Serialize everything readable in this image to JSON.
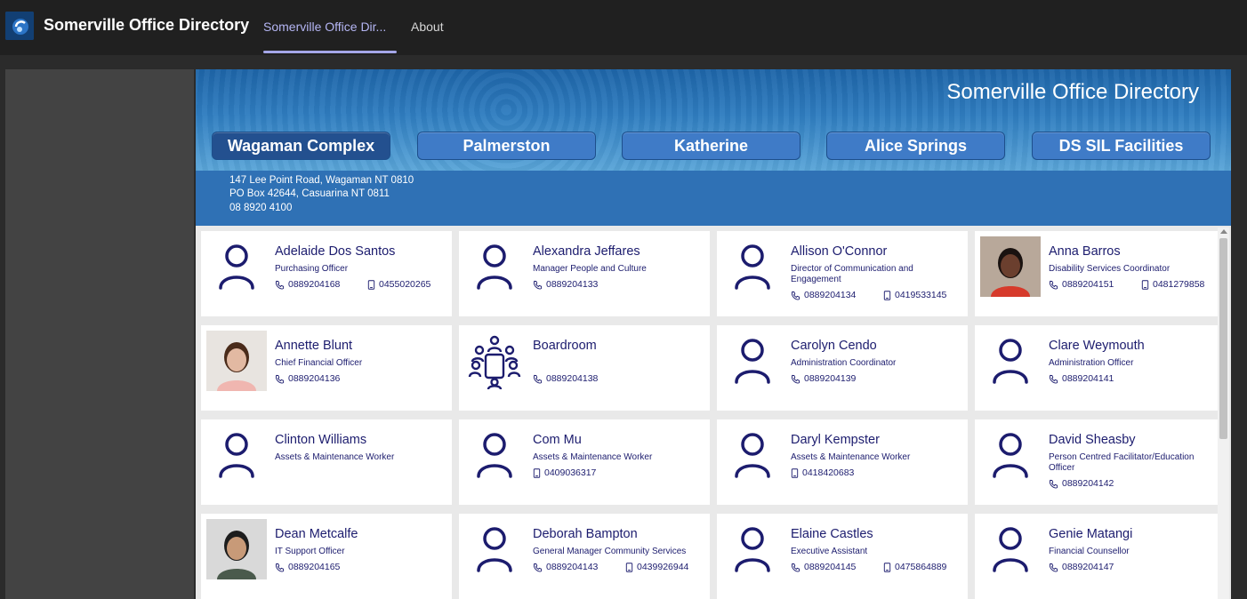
{
  "app": {
    "title": "Somerville Office Directory",
    "tabs": [
      {
        "label": "Somerville Office Dir...",
        "active": true
      },
      {
        "label": "About",
        "active": false
      }
    ]
  },
  "banner": {
    "title": "Somerville Office Directory",
    "locations": [
      {
        "label": "Wagaman Complex",
        "active": true
      },
      {
        "label": "Palmerston",
        "active": false
      },
      {
        "label": "Katherine",
        "active": false
      },
      {
        "label": "Alice Springs",
        "active": false
      },
      {
        "label": "DS SIL Facilities",
        "active": false
      }
    ],
    "address": [
      "147 Lee Point Road, Wagaman NT 0810",
      "PO Box 42644, Casuarina NT 0811",
      "08 8920 4100"
    ]
  },
  "contacts": [
    {
      "name": "Adelaide Dos Santos",
      "role": "Purchasing Officer",
      "phone": "0889204168",
      "mobile": "0455020265",
      "avatar": "person-icon"
    },
    {
      "name": "Alexandra Jeffares",
      "role": "Manager People and Culture",
      "phone": "0889204133",
      "mobile": "",
      "avatar": "person-icon"
    },
    {
      "name": "Allison O'Connor",
      "role": "Director of Communication and Engagement",
      "phone": "0889204134",
      "mobile": "0419533145",
      "avatar": "person-icon"
    },
    {
      "name": "Anna Barros",
      "role": "Disability Services Coordinator",
      "phone": "0889204151",
      "mobile": "0481279858",
      "avatar": "photo"
    },
    {
      "name": "Annette Blunt",
      "role": "Chief Financial Officer",
      "phone": "0889204136",
      "mobile": "",
      "avatar": "photo"
    },
    {
      "name": "Boardroom",
      "role": "",
      "phone": "0889204138",
      "mobile": "",
      "avatar": "meeting-room-icon"
    },
    {
      "name": "Carolyn Cendo",
      "role": "Administration Coordinator",
      "phone": "0889204139",
      "mobile": "",
      "avatar": "person-icon"
    },
    {
      "name": "Clare Weymouth",
      "role": "Administration Officer",
      "phone": "0889204141",
      "mobile": "",
      "avatar": "person-icon"
    },
    {
      "name": "Clinton Williams",
      "role": "Assets & Maintenance Worker",
      "phone": "",
      "mobile": "",
      "avatar": "person-icon"
    },
    {
      "name": "Com Mu",
      "role": "Assets & Maintenance Worker",
      "phone": "",
      "mobile": "0409036317",
      "avatar": "person-icon"
    },
    {
      "name": "Daryl Kempster",
      "role": "Assets & Maintenance Worker",
      "phone": "",
      "mobile": "0418420683",
      "avatar": "person-icon"
    },
    {
      "name": "David Sheasby",
      "role": "Person Centred Facilitator/Education Officer",
      "phone": "0889204142",
      "mobile": "",
      "avatar": "person-icon"
    },
    {
      "name": "Dean Metcalfe",
      "role": "IT Support Officer",
      "phone": "0889204165",
      "mobile": "",
      "avatar": "photo"
    },
    {
      "name": "Deborah Bampton",
      "role": "General Manager Community Services",
      "phone": "0889204143",
      "mobile": "0439926944",
      "avatar": "person-icon"
    },
    {
      "name": "Elaine Castles",
      "role": "Executive Assistant",
      "phone": "0889204145",
      "mobile": "0475864889",
      "avatar": "person-icon"
    },
    {
      "name": "Genie Matangi",
      "role": "Financial Counsellor",
      "phone": "0889204147",
      "mobile": "",
      "avatar": "person-icon"
    }
  ],
  "colors": {
    "accent": "#a5a6e8",
    "card_text": "#1c1c6e",
    "banner": "#2f71b5",
    "active_location": "#23508f"
  }
}
